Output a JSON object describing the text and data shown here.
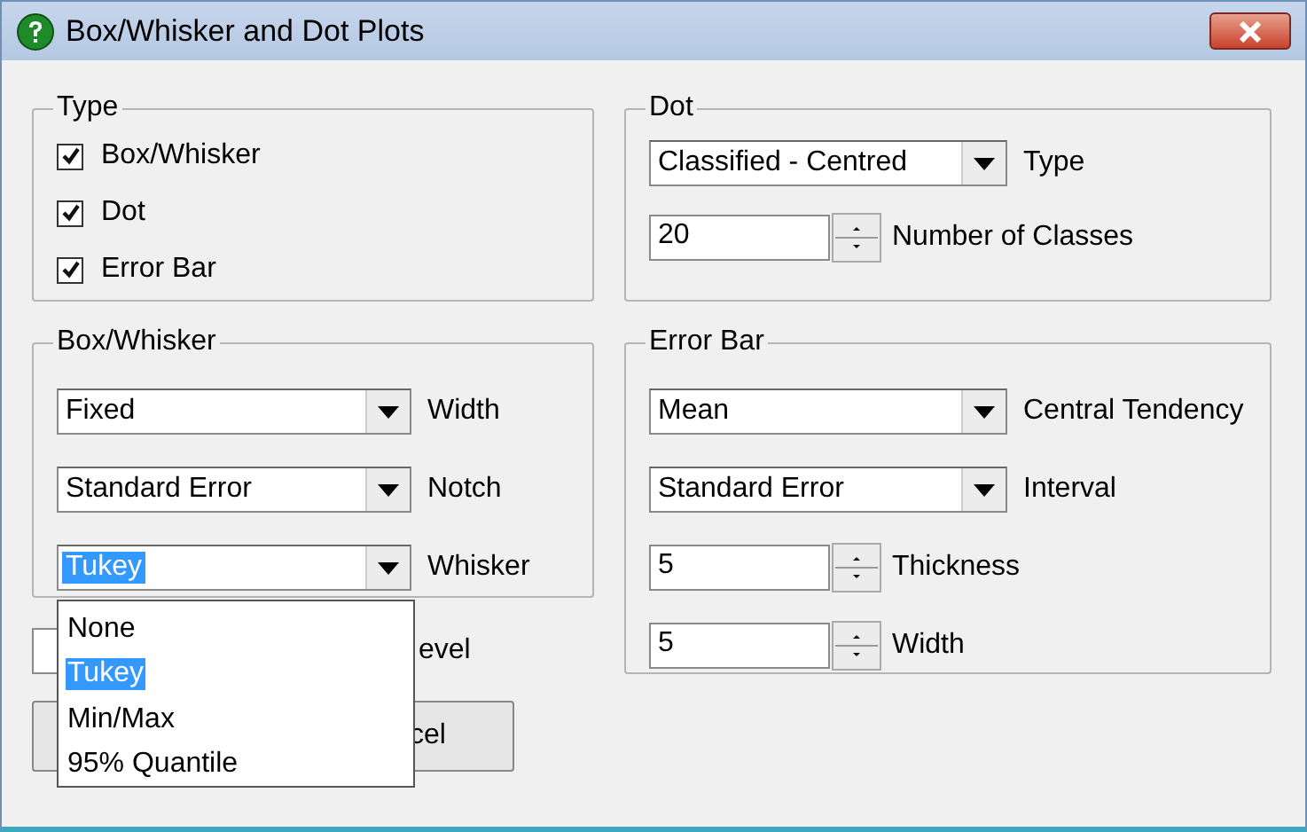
{
  "window": {
    "title": "Box/Whisker and Dot Plots"
  },
  "type_group": {
    "title": "Type",
    "options": [
      {
        "label": "Box/Whisker",
        "checked": true
      },
      {
        "label": "Dot",
        "checked": true
      },
      {
        "label": "Error Bar",
        "checked": true
      }
    ]
  },
  "box_whisker_group": {
    "title": "Box/Whisker",
    "selects": [
      {
        "value": "Fixed",
        "label": "Width",
        "focused": false
      },
      {
        "value": "Standard Error",
        "label": "Notch",
        "focused": false
      },
      {
        "value": "Tukey",
        "label": "Whisker",
        "focused": true
      }
    ]
  },
  "level_row": {
    "label": "evel"
  },
  "buttons": [
    {
      "label": "cel"
    }
  ],
  "dot_group": {
    "title": "Dot",
    "type_select": {
      "value": "Classified - Centred",
      "label": "Type"
    },
    "classes": {
      "value": "20",
      "label": "Number of Classes"
    }
  },
  "error_bar_group": {
    "title": "Error Bar",
    "selects": [
      {
        "value": "Mean",
        "label": "Central Tendency"
      },
      {
        "value": "Standard Error",
        "label": "Interval"
      }
    ],
    "spinners": [
      {
        "value": "5",
        "label": "Thickness"
      },
      {
        "value": "5",
        "label": "Width"
      }
    ]
  },
  "dropdown": {
    "items": [
      {
        "label": "None",
        "selected": false
      },
      {
        "label": "Tukey",
        "selected": true
      },
      {
        "label": "Min/Max",
        "selected": false
      },
      {
        "label": "95% Quantile",
        "selected": false
      }
    ]
  }
}
